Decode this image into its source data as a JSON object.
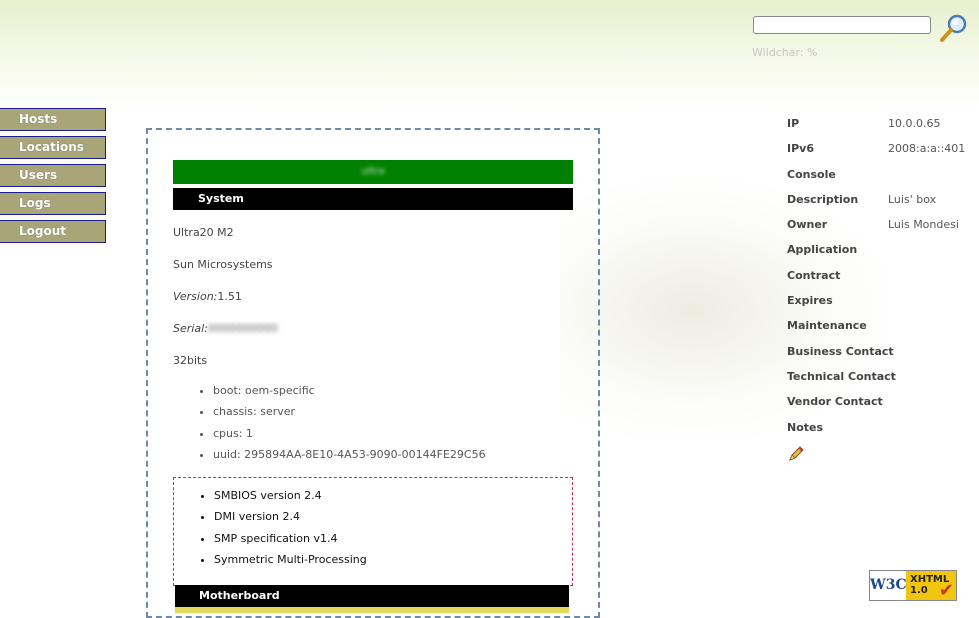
{
  "search": {
    "value": "",
    "hint": "Wildchar: %"
  },
  "nav": {
    "items": [
      "Hosts",
      "Locations",
      "Users",
      "Logs",
      "Logout"
    ]
  },
  "host": {
    "name": "ultra",
    "section_system": "System",
    "model": "Ultra20 M2",
    "vendor": "Sun Microsystems",
    "version_label": "Version:",
    "version_value": "1.51",
    "serial_label": "Serial:",
    "serial_value": "0000000000",
    "bits": "32bits",
    "features": [
      "boot: oem-specific",
      "chassis: server",
      "cpus: 1",
      "uuid: 295894AA-8E10-4A53-9090-00144FE29C56"
    ],
    "bios": [
      "SMBIOS version 2.4",
      "DMI version 2.4",
      "SMP specification v1.4",
      "Symmetric Multi-Processing"
    ],
    "section_motherboard": "Motherboard"
  },
  "info": {
    "rows": [
      {
        "label": "IP",
        "value": "10.0.0.65"
      },
      {
        "label": "IPv6",
        "value": "2008:a:a::401"
      },
      {
        "label": "Console",
        "value": ""
      },
      {
        "label": "Description",
        "value": "Luis' box"
      },
      {
        "label": "Owner",
        "value": "Luis Mondesi"
      },
      {
        "label": "Application",
        "value": ""
      },
      {
        "label": "Contract",
        "value": ""
      },
      {
        "label": "Expires",
        "value": ""
      },
      {
        "label": "Maintenance",
        "value": ""
      },
      {
        "label": "Business Contact",
        "value": ""
      },
      {
        "label": "Technical Contact",
        "value": ""
      },
      {
        "label": "Vendor Contact",
        "value": ""
      },
      {
        "label": "Notes",
        "value": ""
      }
    ]
  },
  "badge": {
    "w3c": "W3C",
    "line1": "XHTML",
    "line2": "1.0"
  },
  "icons": {
    "search": "magnifier-icon",
    "edit": "pencil-icon",
    "check": "checkmark-icon"
  },
  "colors": {
    "host_bar": "#008000",
    "nav_button": "#a8a679",
    "nav_border": "#1c1c8a",
    "panel_border": "#6f8aa8",
    "bios_border": "#c0304f"
  }
}
